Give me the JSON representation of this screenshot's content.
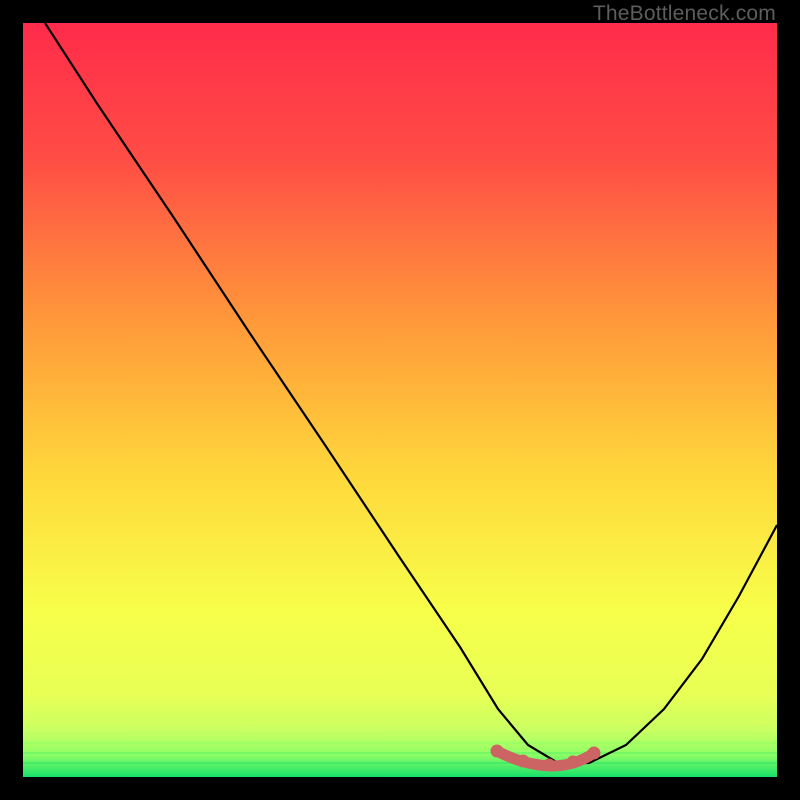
{
  "watermark": "TheBottleneck.com",
  "colors": {
    "bg": "#000000",
    "grad_top": "#ff2b4a",
    "grad_mid1": "#ff8a3a",
    "grad_mid2": "#ffd83b",
    "grad_mid3": "#f7ff4a",
    "grad_low": "#d6ff6a",
    "grad_bottom": "#17e06a",
    "curve": "#000000",
    "marker": "#cc6464"
  },
  "chart_data": {
    "type": "line",
    "title": "",
    "xlabel": "",
    "ylabel": "",
    "xlim": [
      0,
      100
    ],
    "ylim": [
      0,
      100
    ],
    "series": [
      {
        "name": "bottleneck-curve",
        "x": [
          3,
          10,
          20,
          30,
          40,
          50,
          58,
          63,
          67,
          71,
          75,
          80,
          85,
          90,
          95,
          100
        ],
        "y": [
          100,
          89,
          74,
          59,
          44,
          29,
          17,
          9,
          4,
          2,
          2,
          4,
          9,
          16,
          24,
          33
        ]
      }
    ],
    "markers": {
      "name": "highlight-band",
      "x": [
        63,
        66,
        69,
        72,
        75
      ],
      "y": [
        3.2,
        2.3,
        2.0,
        2.1,
        3.0
      ]
    },
    "gradient_bands": [
      {
        "y": 100,
        "color": "#ff2b4a"
      },
      {
        "y": 55,
        "color": "#ffb03a"
      },
      {
        "y": 30,
        "color": "#ffe23b"
      },
      {
        "y": 12,
        "color": "#f2ff5a"
      },
      {
        "y": 4,
        "color": "#b8ff6a"
      },
      {
        "y": 0,
        "color": "#17e06a"
      }
    ]
  }
}
